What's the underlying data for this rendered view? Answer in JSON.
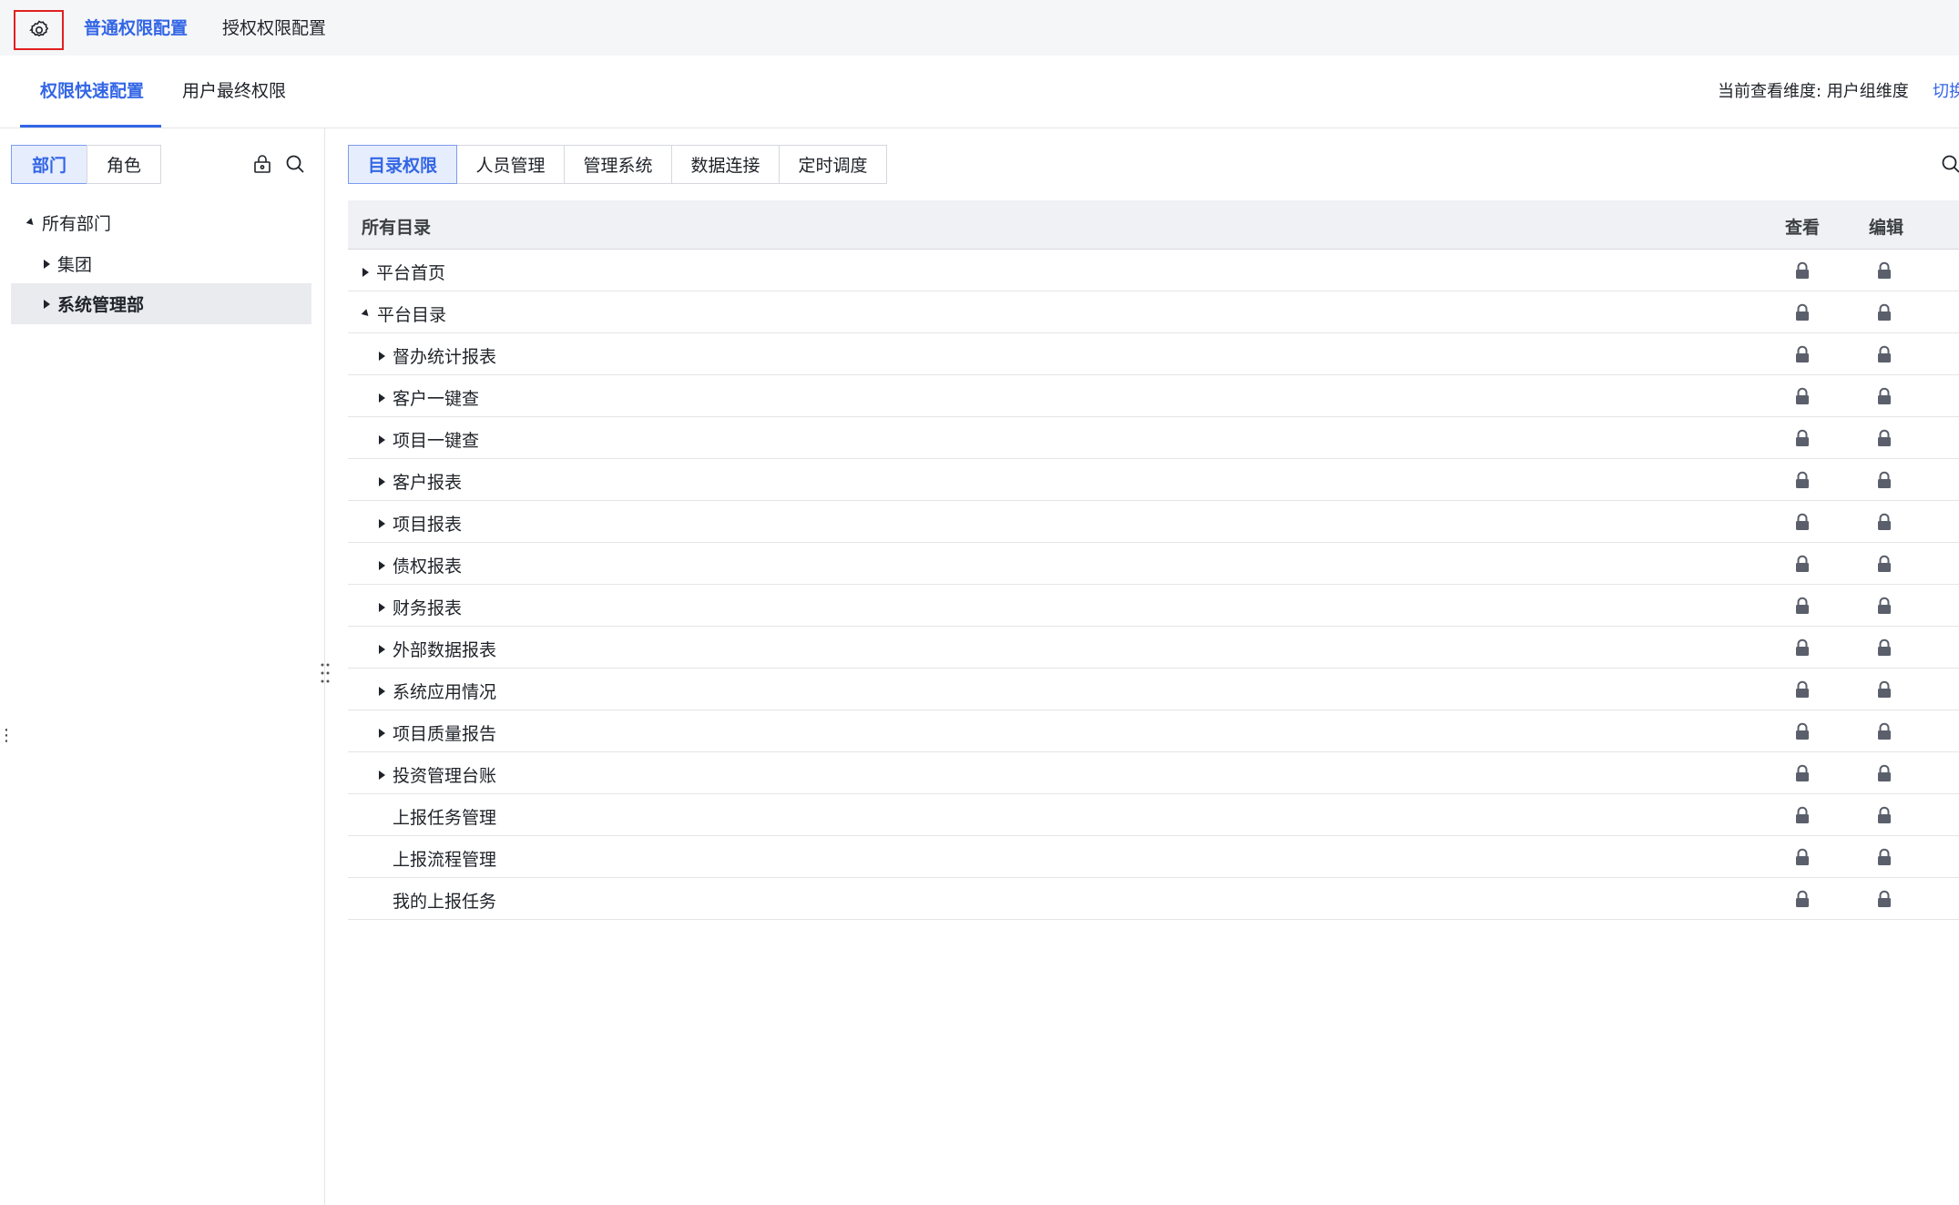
{
  "topbar": {
    "settings_icon": "gear-icon",
    "tabs": [
      {
        "label": "普通权限配置",
        "active": true
      },
      {
        "label": "授权权限配置",
        "active": false
      }
    ]
  },
  "subbar": {
    "tabs": [
      {
        "label": "权限快速配置",
        "active": true
      },
      {
        "label": "用户最终权限",
        "active": false
      }
    ],
    "dimension_label": "当前查看维度: 用户组维度",
    "switch_label": "切换"
  },
  "left": {
    "segments": [
      {
        "label": "部门",
        "active": true
      },
      {
        "label": "角色",
        "active": false
      }
    ],
    "icons": [
      "lock-settings-icon",
      "search-icon"
    ],
    "tree": [
      {
        "label": "所有部门",
        "expanded": true,
        "level": 0
      },
      {
        "label": "集团",
        "expanded": false,
        "level": 1
      },
      {
        "label": "系统管理部",
        "expanded": false,
        "level": 1,
        "selected": true
      }
    ]
  },
  "right": {
    "tabs": [
      {
        "label": "目录权限",
        "active": true
      },
      {
        "label": "人员管理",
        "active": false
      },
      {
        "label": "管理系统",
        "active": false
      },
      {
        "label": "数据连接",
        "active": false
      },
      {
        "label": "定时调度",
        "active": false
      }
    ],
    "table": {
      "headers": {
        "name": "所有目录",
        "view": "查看",
        "edit": "编辑"
      },
      "rows": [
        {
          "label": "平台首页",
          "level": 0,
          "arrow": "right"
        },
        {
          "label": "平台目录",
          "level": 0,
          "arrow": "down"
        },
        {
          "label": "督办统计报表",
          "level": 1,
          "arrow": "right"
        },
        {
          "label": "客户一键查",
          "level": 1,
          "arrow": "right"
        },
        {
          "label": "项目一键查",
          "level": 1,
          "arrow": "right"
        },
        {
          "label": "客户报表",
          "level": 1,
          "arrow": "right"
        },
        {
          "label": "项目报表",
          "level": 1,
          "arrow": "right"
        },
        {
          "label": "债权报表",
          "level": 1,
          "arrow": "right"
        },
        {
          "label": "财务报表",
          "level": 1,
          "arrow": "right"
        },
        {
          "label": "外部数据报表",
          "level": 1,
          "arrow": "right"
        },
        {
          "label": "系统应用情况",
          "level": 1,
          "arrow": "right"
        },
        {
          "label": "项目质量报告",
          "level": 1,
          "arrow": "right"
        },
        {
          "label": "投资管理台账",
          "level": 1,
          "arrow": "right"
        },
        {
          "label": "上报任务管理",
          "level": 1,
          "arrow": "none"
        },
        {
          "label": "上报流程管理",
          "level": 1,
          "arrow": "none"
        },
        {
          "label": "我的上报任务",
          "level": 1,
          "arrow": "none"
        }
      ]
    }
  },
  "colors": {
    "accent": "#3366e6",
    "lock": "#5a5f6b",
    "highlight_border": "#e02020"
  }
}
